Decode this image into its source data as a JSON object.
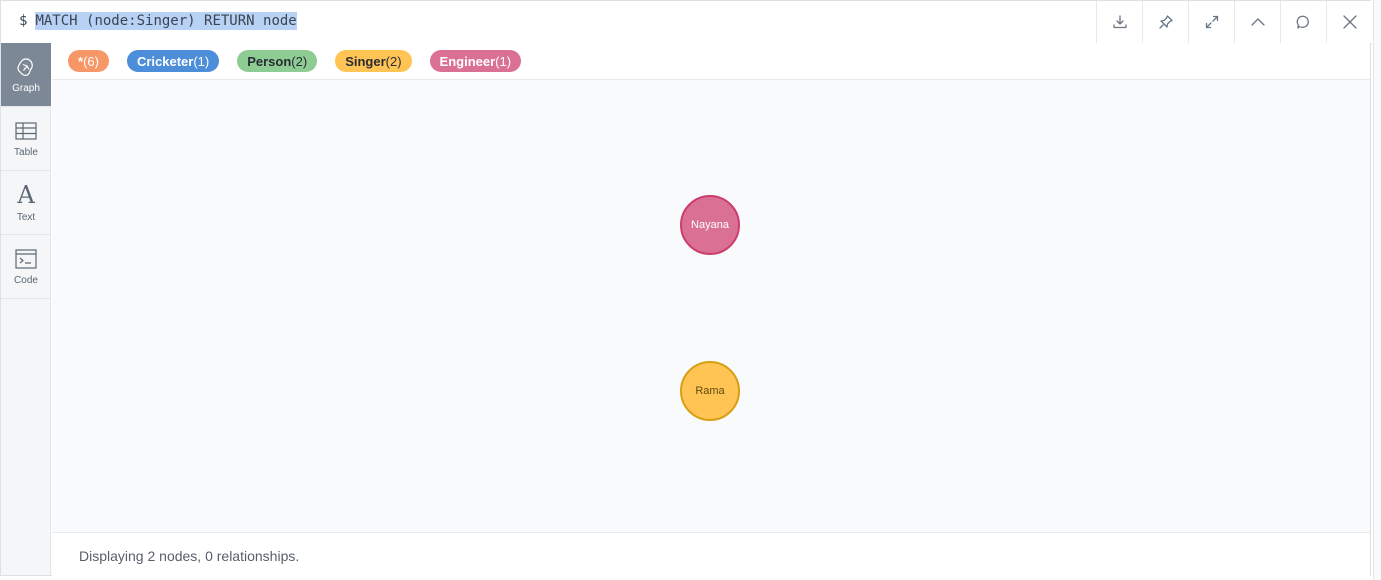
{
  "command": {
    "prompt": "$",
    "query": "MATCH (node:Singer) RETURN node"
  },
  "toolbar": {
    "buttons": [
      "download-icon",
      "pin-icon",
      "expand-icon",
      "collapse-icon",
      "refresh-icon",
      "close-icon"
    ]
  },
  "side_nav": {
    "items": [
      {
        "label": "Graph",
        "icon": "graph-icon",
        "active": true
      },
      {
        "label": "Table",
        "icon": "table-icon",
        "active": false
      },
      {
        "label": "Text",
        "icon": "text-icon",
        "active": false
      },
      {
        "label": "Code",
        "icon": "code-icon",
        "active": false
      }
    ]
  },
  "labels": [
    {
      "name": "*",
      "count": "(6)",
      "color": "#f79767",
      "text_color": "#ffffff"
    },
    {
      "name": "Cricketer",
      "count": "(1)",
      "color": "#4c8eda",
      "text_color": "#ffffff"
    },
    {
      "name": "Person",
      "count": "(2)",
      "color": "#8dcc93",
      "text_color": "#2a2c34"
    },
    {
      "name": "Singer",
      "count": "(2)",
      "color": "#ffc454",
      "text_color": "#2a2c34"
    },
    {
      "name": "Engineer",
      "count": "(1)",
      "color": "#da7194",
      "text_color": "#ffffff"
    }
  ],
  "nodes": [
    {
      "caption": "Nayana",
      "fill": "#da7194",
      "border": "#cc3c6c",
      "text_color": "#ffffff"
    },
    {
      "caption": "Rama",
      "fill": "#ffc454",
      "border": "#d7a013",
      "text_color": "#604a0e"
    }
  ],
  "status": "Displaying 2 nodes, 0 relationships."
}
